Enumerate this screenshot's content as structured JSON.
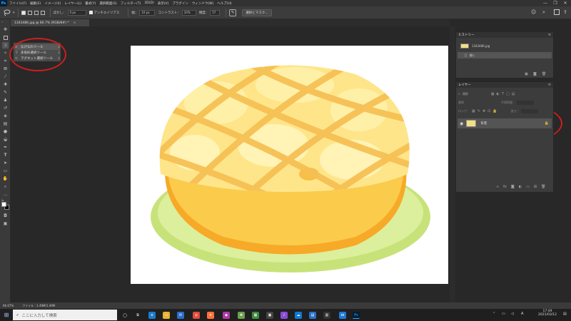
{
  "menu": {
    "logo": "Ps",
    "items": [
      "ファイル(F)",
      "編集(E)",
      "イメージ(I)",
      "レイヤー(L)",
      "書式(Y)",
      "選択範囲(S)",
      "フィルター(T)",
      "3D(D)",
      "表示(V)",
      "プラグイン",
      "ウィンドウ(W)",
      "ヘルプ(H)"
    ],
    "window_controls": [
      "—",
      "❐",
      "✕"
    ]
  },
  "options": {
    "feather_label": "ぼかし：",
    "feather_value": "0 px",
    "antialias_label": "アンチエイリアス",
    "width_label": "幅：",
    "width_value": "10 px",
    "contrast_label": "コントラスト：",
    "contrast_value": "10%",
    "frequency_label": "頻度：",
    "frequency_value": "57",
    "select_mask_label": "選択とマスク..."
  },
  "document": {
    "tab_title": "1343486.jpg @ 66.7% (RGB/8#) *",
    "tab_close": "×"
  },
  "flyout": {
    "items": [
      {
        "label": "なげなわツール",
        "key": "L",
        "icon": "lasso-icon"
      },
      {
        "label": "多角形選択ツール",
        "key": "L",
        "icon": "polygonal-lasso-icon"
      },
      {
        "label": "マグネット選択ツール",
        "key": "L",
        "icon": "magnetic-lasso-icon"
      }
    ]
  },
  "history": {
    "tab_label": "ヒストリー",
    "snapshot_name": "1343486.jpg",
    "state_label": "開く"
  },
  "layers": {
    "tab_label": "レイヤー",
    "filter_placeholder": "種類",
    "mode_label": "通常",
    "opacity_label": "不透明度：",
    "lock_label": "ロック：",
    "fill_label": "塗り：",
    "layer_name": "背景"
  },
  "status": {
    "zoom": "66.67%",
    "file_info": "ファイル : 1.49M/1.49M"
  },
  "taskbar": {
    "search_placeholder": "ここに入力して検索",
    "time": "17:49",
    "date": "2021/03/12",
    "ime_label": "A"
  },
  "colors": {
    "accent": "#31a8ff",
    "annotation": "#d11d1d",
    "canvas_bg": "#ffffff"
  }
}
